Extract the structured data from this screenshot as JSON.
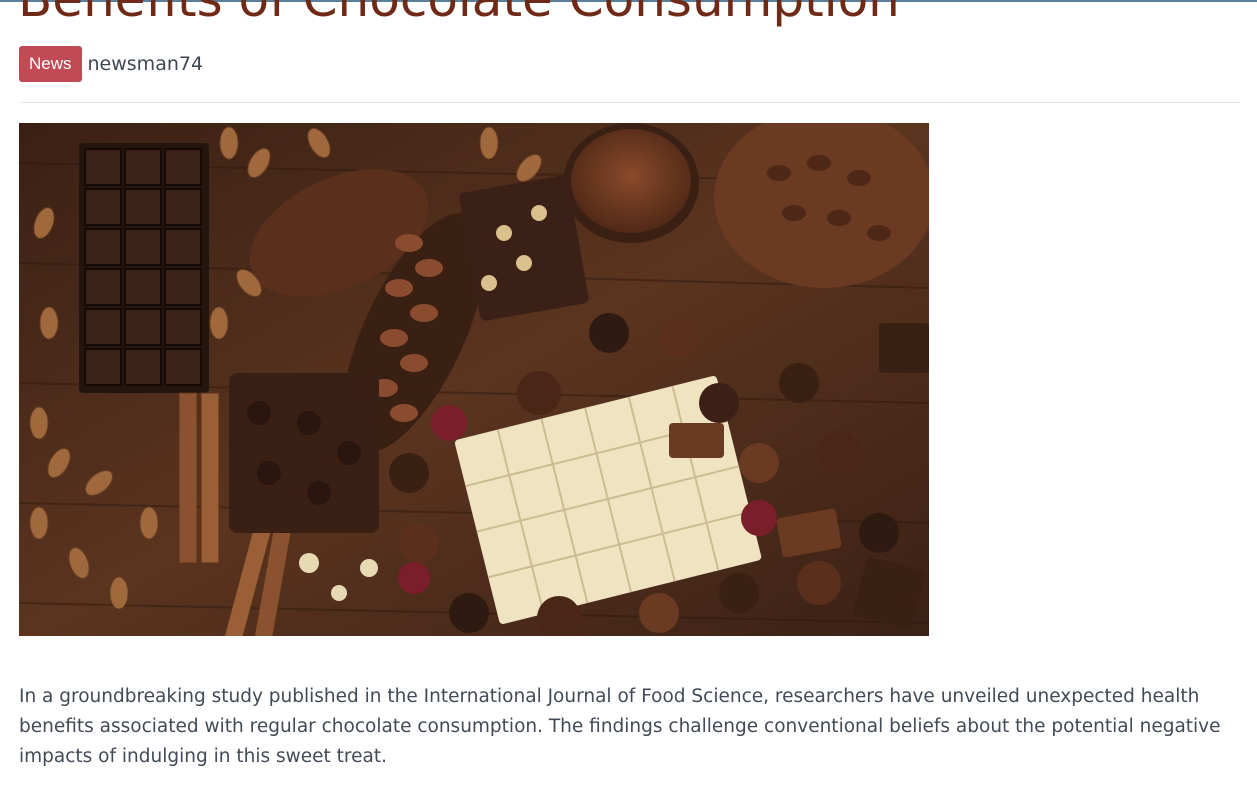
{
  "article": {
    "title": "Benefits of Chocolate Consumption",
    "category_badge": "News",
    "author": "newsman74",
    "hero_image_alt": "Assorted chocolates, cocoa beans, almonds and cinnamon sticks",
    "body": "In a groundbreaking study published in the International Journal of Food Science, researchers have unveiled unexpected health benefits associated with regular chocolate consumption. The findings challenge conventional beliefs about the potential negative impacts of indulging in this sweet treat."
  },
  "colors": {
    "title": "#6f2a17",
    "badge": "#c24a55",
    "text": "#414a56",
    "wood": "#4a2a18",
    "dark_chocolate": "#2a1812",
    "milk_chocolate": "#6b3a22",
    "white_chocolate": "#efe3c2"
  }
}
